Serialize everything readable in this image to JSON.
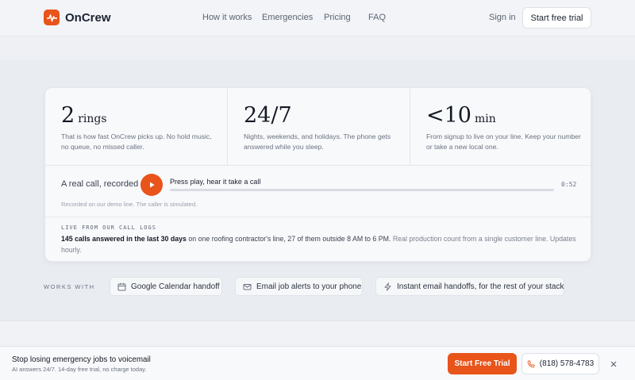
{
  "header": {
    "brand": "OnCrew",
    "nav": [
      "How it works",
      "Emergencies",
      "Pricing",
      "FAQ"
    ],
    "signin": "Sign in",
    "cta": "Start free trial"
  },
  "stats": [
    {
      "value": "2",
      "unit": "rings",
      "desc": "That is how fast OnCrew picks up. No hold music, no queue, no missed caller."
    },
    {
      "value": "24/7",
      "unit": "",
      "desc": "Nights, weekends, and holidays. The phone gets answered while you sleep."
    },
    {
      "value": "<10",
      "unit": "min",
      "desc": "From signup to live on your line. Keep your number or take a new local one."
    }
  ],
  "demo": {
    "label": "A real call, recorded",
    "title": "Press play, hear it take a call",
    "time": "0:52",
    "note": "Recorded on our demo line. The caller is simulated."
  },
  "live": {
    "label": "LIVE FROM OUR CALL LOGS",
    "bold": "145 calls answered in the last 30 days",
    "text": " on one roofing contractor's line, 27 of them outside 8 AM to 6 PM.",
    "muted": " Real production count from a single customer line. Updates hourly."
  },
  "works_with": {
    "label": "WORKS WITH",
    "chips": [
      {
        "label": "Google Calendar handoff",
        "icon": "calendar-icon"
      },
      {
        "label": "Email job alerts to your phone",
        "icon": "mail-icon"
      },
      {
        "label": "Instant email handoffs, for the rest of your stack",
        "icon": "bolt-icon"
      }
    ]
  },
  "bottom_bar": {
    "title": "Stop losing emergency jobs to voicemail",
    "subtitle": "AI answers 24/7. 14-day free trial, no charge today.",
    "cta": "Start Free Trial",
    "phone": "(818) 578-4783"
  },
  "colors": {
    "accent": "#e8541a",
    "background": "#e9ecf1",
    "card": "#f8f9fb"
  }
}
